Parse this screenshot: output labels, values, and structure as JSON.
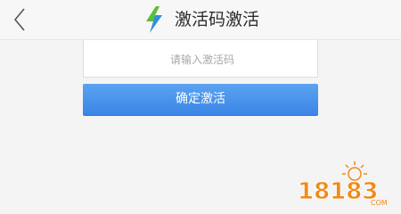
{
  "header": {
    "title": "激活码激活",
    "back_icon": "chevron-left-icon",
    "logo_icon": "lightning-bolt-icon"
  },
  "form": {
    "code_placeholder": "请输入激活码",
    "code_value": "",
    "submit_label": "确定激活"
  },
  "watermark": {
    "text": "18183",
    "suffix": "COM"
  },
  "colors": {
    "header_bg": "#f7f7f7",
    "page_bg": "#f4f4f4",
    "button_blue": "#4a93ec",
    "watermark_orange": "#f08a1a"
  }
}
